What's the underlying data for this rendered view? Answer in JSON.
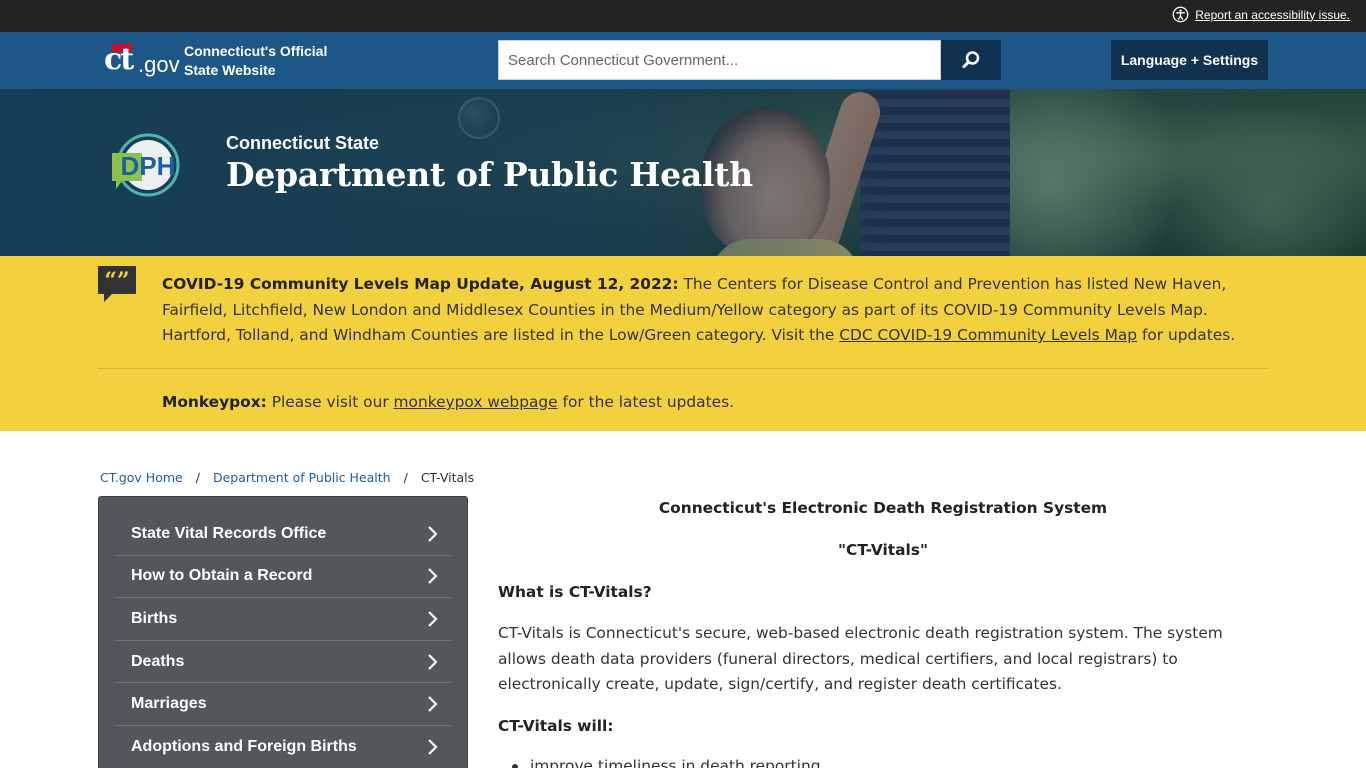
{
  "utility": {
    "accessibility_link": "Report an accessibility issue."
  },
  "header": {
    "logo_ct": "ct",
    "logo_gov": ".gov",
    "site_name_line1": "Connecticut's Official",
    "site_name_line2": "State Website",
    "search_placeholder": "Search Connecticut Government...",
    "language_button": "Language + Settings"
  },
  "hero": {
    "logo_text": "DPH",
    "subtitle": "Connecticut State",
    "title": "Department of Public Health"
  },
  "alerts": {
    "covid_bold": "COVID-19 Community Levels Map Update, August 12, 2022:",
    "covid_text": " The Centers for Disease Control and Prevention has listed New Haven, Fairfield, Litchfield, New London and Middlesex Counties in the Medium/Yellow category as part of its COVID-19 Community Levels Map. Hartford, Tolland, and Windham Counties are listed in the Low/Green category. Visit the ",
    "covid_link": "CDC COVID-19 Community Levels Map",
    "covid_tail": " for updates.",
    "monkeypox_bold": "Monkeypox:",
    "monkeypox_text": " Please visit our ",
    "monkeypox_link": "monkeypox webpage",
    "monkeypox_tail": " for the latest updates."
  },
  "breadcrumb": {
    "home": "CT.gov Home",
    "dept": "Department of Public Health",
    "current": "CT-Vitals",
    "separator": "/"
  },
  "sidenav": {
    "items": [
      {
        "label": "State Vital Records Office"
      },
      {
        "label": "How to Obtain a Record"
      },
      {
        "label": "Births"
      },
      {
        "label": "Deaths"
      },
      {
        "label": "Marriages"
      },
      {
        "label": "Adoptions and Foreign Births"
      }
    ]
  },
  "content": {
    "title": "Connecticut's Electronic Death Registration System",
    "subtitle": "\"CT-Vitals\"",
    "what_heading": "What is CT-Vitals?",
    "what_paragraph": "CT-Vitals is Connecticut's secure, web-based electronic death registration system. The system allows death data providers (funeral directors, medical certifiers, and local registrars) to electronically create, update, sign/certify, and register death certificates.",
    "will_heading": "CT-Vitals will:",
    "will_items": [
      "improve timeliness in death reporting"
    ]
  },
  "colors": {
    "utility_bar": "#232323",
    "header": "#1d5788",
    "button_dark": "#10314f",
    "alert_yellow": "#f3d03e",
    "sidenav": "#53565a",
    "link": "#1d5ea8"
  }
}
